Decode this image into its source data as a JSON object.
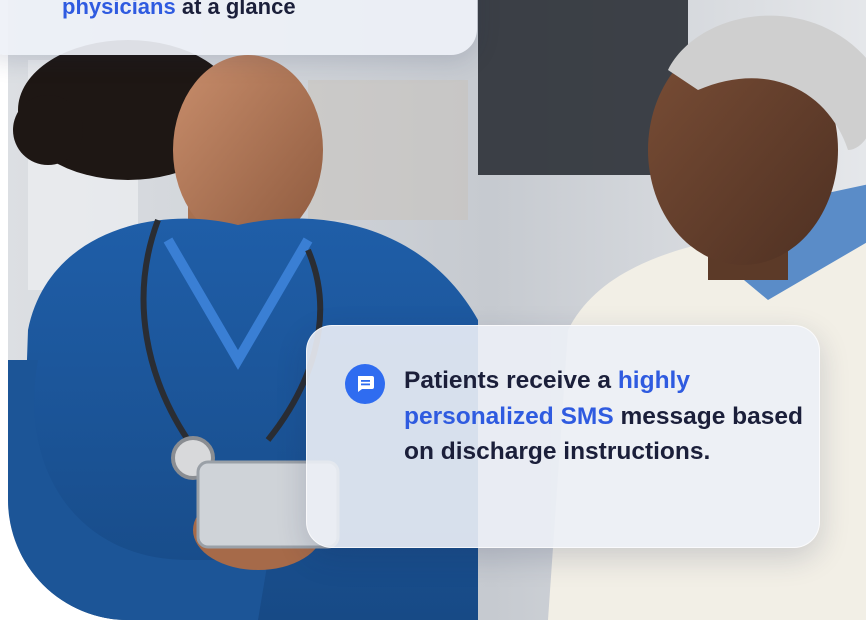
{
  "top_card": {
    "highlight": "physicians",
    "rest": " at a glance"
  },
  "main_card": {
    "icon": "message-icon",
    "part1": "Patients receive a ",
    "highlight": "highly personalized SMS",
    "part2": " message based on discharge instructions."
  },
  "colors": {
    "highlight": "#2f5be0",
    "text": "#1b1f3a",
    "icon_bg": "#2f6cf0"
  }
}
